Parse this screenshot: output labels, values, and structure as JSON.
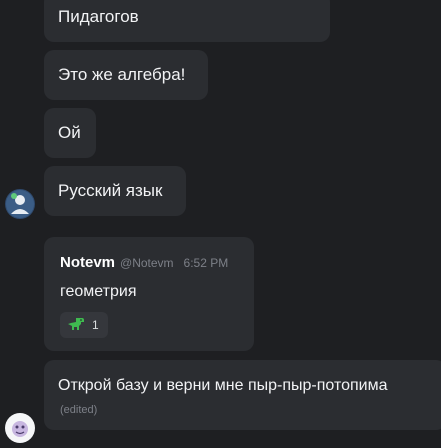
{
  "messages": [
    {
      "text": "Пидагогов"
    },
    {
      "text": "Это же алгебра!"
    },
    {
      "text": "Ой"
    },
    {
      "text": "Русский язык"
    },
    {
      "author": "Notevm",
      "handle": "@Notevm",
      "time": "6:52 PM",
      "text": "геометрия",
      "reaction": {
        "emoji": "dinosaur",
        "count": "1"
      }
    },
    {
      "text": "Открой базу и верни мне пыр-пыр-потопима",
      "edited": "(edited)"
    }
  ],
  "colors": {
    "background": "#1e1f22",
    "bubble": "#2b2d31",
    "text": "#f2f3f5",
    "muted": "#7d8088",
    "reaction_bg": "#35373c",
    "dino": "#3fb950"
  }
}
